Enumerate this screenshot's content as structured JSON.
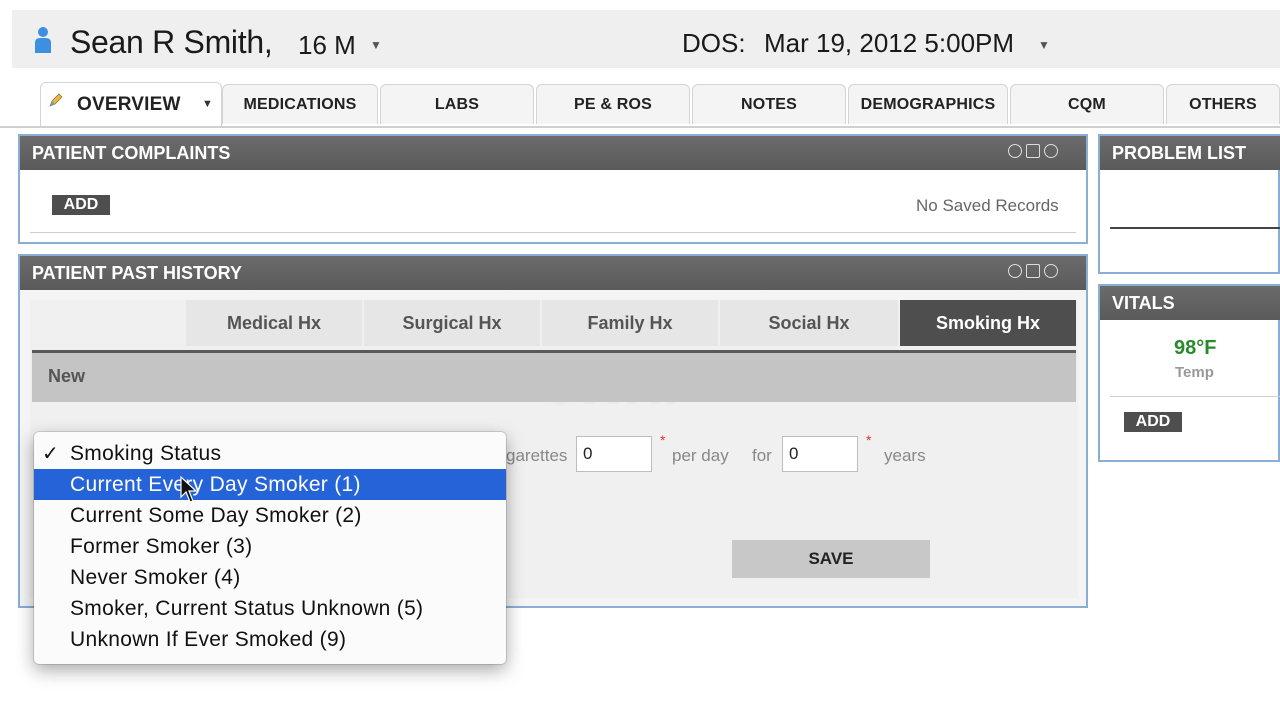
{
  "header": {
    "patient_name": "Sean R Smith,",
    "patient_age_sex": "16 M",
    "dos_label": "DOS:",
    "dos_value": "Mar 19, 2012 5:00PM"
  },
  "tabs": [
    {
      "label": "OVERVIEW"
    },
    {
      "label": "MEDICATIONS"
    },
    {
      "label": "LABS"
    },
    {
      "label": "PE & ROS"
    },
    {
      "label": "NOTES"
    },
    {
      "label": "DEMOGRAPHICS"
    },
    {
      "label": "CQM"
    },
    {
      "label": "OTHERS"
    }
  ],
  "complaints": {
    "title": "PATIENT COMPLAINTS",
    "add_label": "ADD",
    "empty_text": "No Saved Records"
  },
  "history": {
    "title": "PATIENT PAST HISTORY",
    "subtabs": [
      {
        "label": "Medical Hx"
      },
      {
        "label": "Surgical Hx"
      },
      {
        "label": "Family Hx"
      },
      {
        "label": "Social Hx"
      },
      {
        "label": "Smoking Hx"
      }
    ],
    "new_label": "New",
    "cigarettes_label": "garettes",
    "cigarettes_value": "0",
    "per_day_label": "per day",
    "for_label": "for",
    "years_value": "0",
    "years_label": "years",
    "save_label": "SAVE",
    "watermark": "enki"
  },
  "problem_list": {
    "title": "PROBLEM LIST"
  },
  "vitals": {
    "title": "VITALS",
    "temp_value": "98°F",
    "temp_label": "Temp",
    "add_label": "ADD",
    "temp_color": "#2a8a2a"
  },
  "smoking_dropdown": {
    "selected_header": "Smoking Status",
    "options": [
      {
        "label": "Current Every Day Smoker (1)"
      },
      {
        "label": "Current Some Day Smoker (2)"
      },
      {
        "label": "Former Smoker (3)"
      },
      {
        "label": "Never Smoker (4)"
      },
      {
        "label": "Smoker, Current Status Unknown (5)"
      },
      {
        "label": "Unknown If Ever Smoked (9)"
      }
    ],
    "highlight_color": "#2463d8"
  },
  "colors": {
    "panel_border": "#8aaed4",
    "panel_header": "#5f5f5f"
  }
}
